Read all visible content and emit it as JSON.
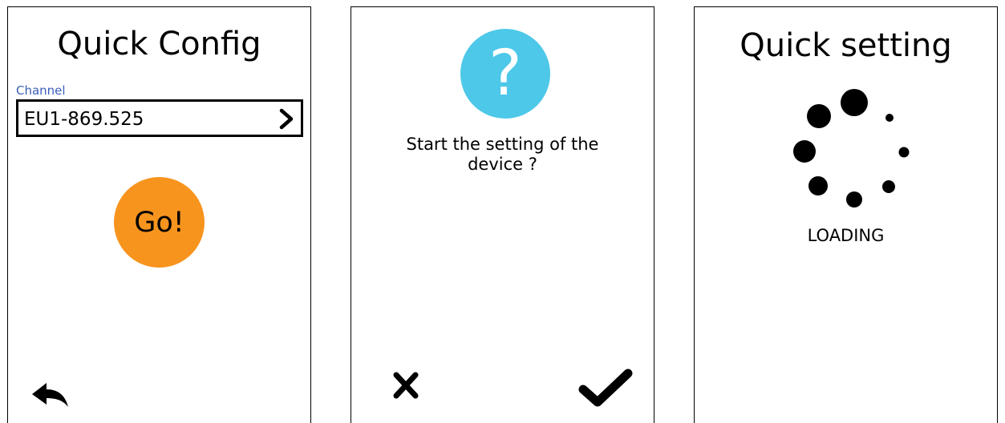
{
  "quick_config": {
    "title": "Quick Config",
    "channel_label": "Channel",
    "channel_value": "EU1-869.525",
    "go_label": "Go!",
    "icons": {
      "next": "chevron-right-icon",
      "back": "back-arrow-icon"
    },
    "colors": {
      "go_button": "#f7941e",
      "channel_label": "#3a5fb8"
    }
  },
  "confirm": {
    "question_glyph": "?",
    "prompt": "Start the setting of the\ndevice ?",
    "icons": {
      "cancel": "close-icon",
      "confirm": "check-icon"
    },
    "colors": {
      "question_circle": "#4dc8e9"
    }
  },
  "quick_setting": {
    "title": "Quick setting",
    "status": "LOADING",
    "icons": {
      "spinner": "loading-spinner-icon"
    }
  }
}
